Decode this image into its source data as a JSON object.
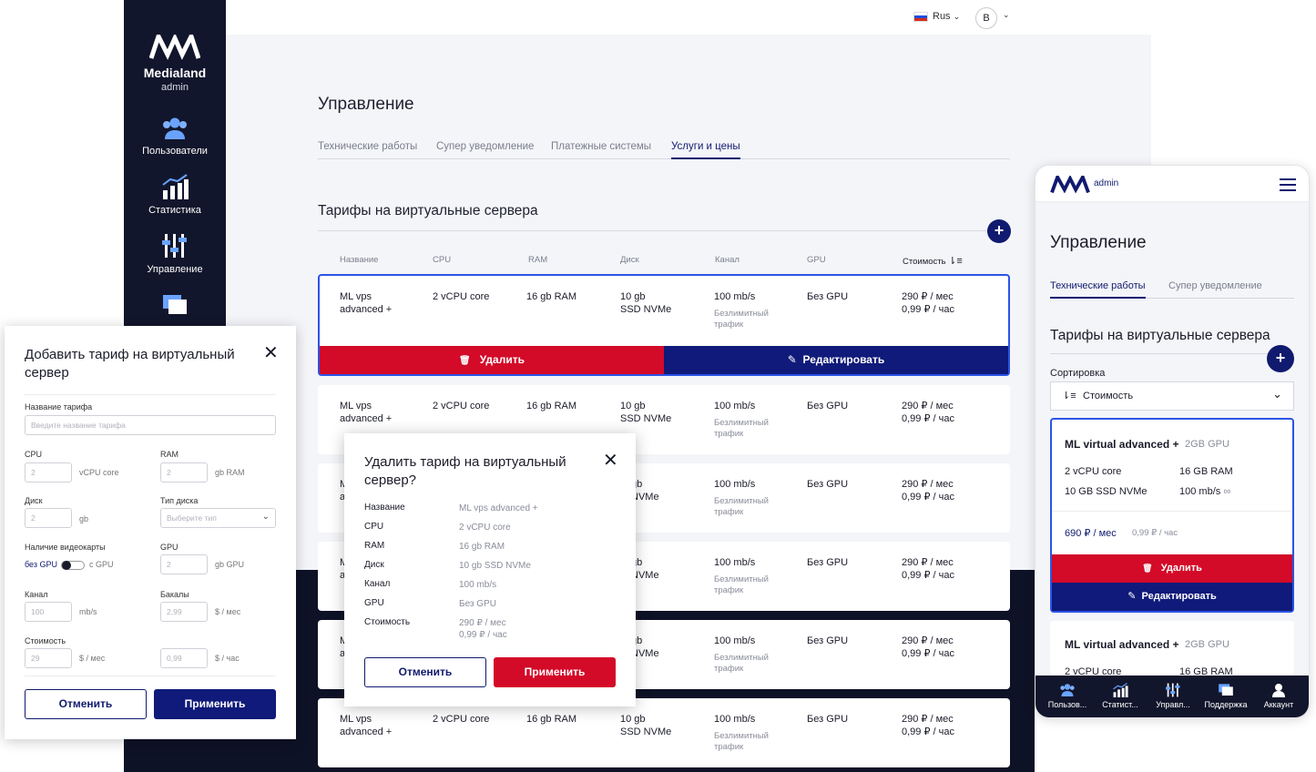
{
  "brand": {
    "name": "Medialand",
    "sub": "admin"
  },
  "sidebar": {
    "items": [
      {
        "label": "Пользователи",
        "icon": "users-icon"
      },
      {
        "label": "Статистика",
        "icon": "chart-icon"
      },
      {
        "label": "Управление",
        "icon": "sliders-icon"
      },
      {
        "label": "",
        "icon": "chat-icon"
      }
    ]
  },
  "header": {
    "lang": "Rus",
    "avatar": "B"
  },
  "page": {
    "title": "Управление",
    "tabs": [
      "Технические работы",
      "Супер уведомление",
      "Платежные системы",
      "Услуги и цены"
    ],
    "active_tab": "Услуги и цены",
    "section_title": "Тарифы на виртуальные сервера",
    "add_symbol": "+",
    "columns": [
      "Название",
      "CPU",
      "RAM",
      "Диск",
      "Канал",
      "GPU",
      "Стоимость"
    ],
    "sort_icon": "⇂≡",
    "row": {
      "name1": "ML vps",
      "name2": "advanced +",
      "cpu": "2 vCPU core",
      "ram": "16 gb RAM",
      "disk1": "10 gb",
      "disk2": "SSD NVMe",
      "channel": "100 mb/s",
      "channel_note1": "Безлимитный",
      "channel_note2": "трафик",
      "gpu": "Без GPU",
      "price_month": "290 ₽ / мес",
      "price_hour": "0,99 ₽ / час",
      "partial_name1": "M",
      "partial_name2": "a",
      "partial_disk1": "gb",
      "partial_disk2": "NVMe"
    },
    "delete_label": "Удалить",
    "edit_label": "Редактировать"
  },
  "add_modal": {
    "title": "Добавить тариф на виртуальный сервер",
    "close": "✕",
    "name_label": "Название тарифа",
    "name_placeholder": "Введите название тарифа",
    "cpu_label": "CPU",
    "cpu_placeholder": "2",
    "cpu_unit": "vCPU core",
    "ram_label": "RAM",
    "ram_placeholder": "2",
    "ram_unit": "gb RAM",
    "disk_label": "Диск",
    "disk_placeholder": "2",
    "disk_unit": "gb",
    "disk_type_label": "Тип диска",
    "disk_type_placeholder": "Выберите тип",
    "gpu_presence_label": "Наличие видеокарты",
    "toggle_off": "без GPU",
    "toggle_on": "с GPU",
    "gpu_label": "GPU",
    "gpu_placeholder": "2",
    "gpu_unit": "gb GPU",
    "channel_label": "Канал",
    "channel_placeholder": "100",
    "channel_unit": "mb/s",
    "bakaly_label": "Бакалы",
    "bakaly_placeholder": "2,99",
    "bakaly_unit": "$ / мес",
    "cost_label": "Стоимость",
    "cost_placeholder": "29",
    "cost_unit": "$ / мес",
    "hour_placeholder": "0,99",
    "hour_unit": "$ / час",
    "cancel": "Отменить",
    "apply": "Применить"
  },
  "delete_modal": {
    "title": "Удалить тариф на виртуальный сервер?",
    "close": "✕",
    "fields": [
      {
        "k": "Название",
        "v": "ML vps advanced +"
      },
      {
        "k": "CPU",
        "v": "2 vCPU core"
      },
      {
        "k": "RAM",
        "v": "16 gb RAM"
      },
      {
        "k": "Диск",
        "v": "10 gb SSD NVMe"
      },
      {
        "k": "Канал",
        "v": "100 mb/s"
      },
      {
        "k": "GPU",
        "v": "Без GPU"
      },
      {
        "k": "Стоимость",
        "v": "290 ₽ / мес",
        "v2": "0,99 ₽ / час"
      }
    ],
    "cancel": "Отменить",
    "apply": "Применить"
  },
  "mobile": {
    "brand_sub": "admin",
    "title": "Управление",
    "tabs": [
      "Технические работы",
      "Супер уведомление"
    ],
    "section_title": "Тарифы на виртуальные сервера",
    "sort_label": "Сортировка",
    "sort_value": "Стоимость",
    "card": {
      "name": "ML virtual advanced +",
      "gpu": "2GB GPU",
      "cpu": "2 vCPU core",
      "ram": "16 GB RAM",
      "disk": "10 GB SSD NVMe",
      "channel": "100 mb/s",
      "infinity": "∞",
      "price_month": "690 ₽ / мес",
      "price_hour": "0,99 ₽ / час"
    },
    "delete_label": "Удалить",
    "edit_label": "Редактировать",
    "nav": [
      "Пользов...",
      "Статист...",
      "Управл...",
      "Поддержка",
      "Аккаунт"
    ]
  },
  "colors": {
    "navy": "#101a6f",
    "red": "#d30a28",
    "sidebar": "#12162c",
    "blue_border": "#2c54e6"
  }
}
